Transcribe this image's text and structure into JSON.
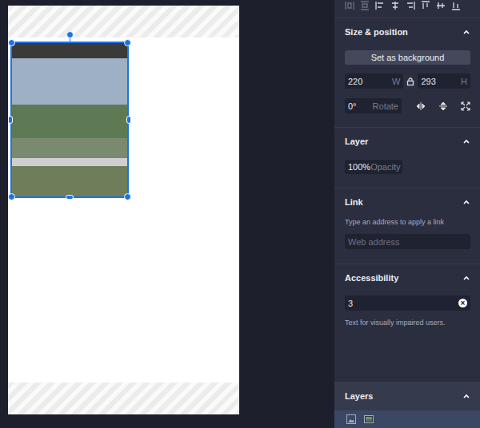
{
  "canvas": {
    "image": {
      "selected": true
    }
  },
  "toolbar": [
    {
      "kind": "distribute-h",
      "disabled": true
    },
    {
      "kind": "distribute-v",
      "disabled": true
    },
    {
      "kind": "align-left",
      "disabled": false
    },
    {
      "kind": "align-center",
      "disabled": false
    },
    {
      "kind": "align-right",
      "disabled": false
    },
    {
      "kind": "align-top",
      "disabled": false
    },
    {
      "kind": "align-middle",
      "disabled": false
    },
    {
      "kind": "align-bottom",
      "disabled": false
    }
  ],
  "size_position": {
    "title": "Size & position",
    "expanded": true,
    "button": "Set as background",
    "width": {
      "value": "220",
      "unit": "W"
    },
    "height": {
      "value": "293",
      "unit": "H"
    },
    "locked": true,
    "rotate": {
      "value": "0°",
      "label": "Rotate"
    }
  },
  "layer": {
    "title": "Layer",
    "expanded": true,
    "opacity": {
      "value": "100%",
      "label": "Opacity"
    }
  },
  "link": {
    "title": "Link",
    "expanded": true,
    "hint": "Type an address to apply a link",
    "placeholder": "Web address"
  },
  "accessibility": {
    "title": "Accessibility",
    "expanded": true,
    "value": "3",
    "clear": "×",
    "hint": "Text for visually impaired users."
  },
  "layers": {
    "title": "Layers",
    "expanded": true,
    "row_selected": true,
    "items": [
      {
        "kind": "image"
      },
      {
        "kind": "background"
      }
    ]
  }
}
